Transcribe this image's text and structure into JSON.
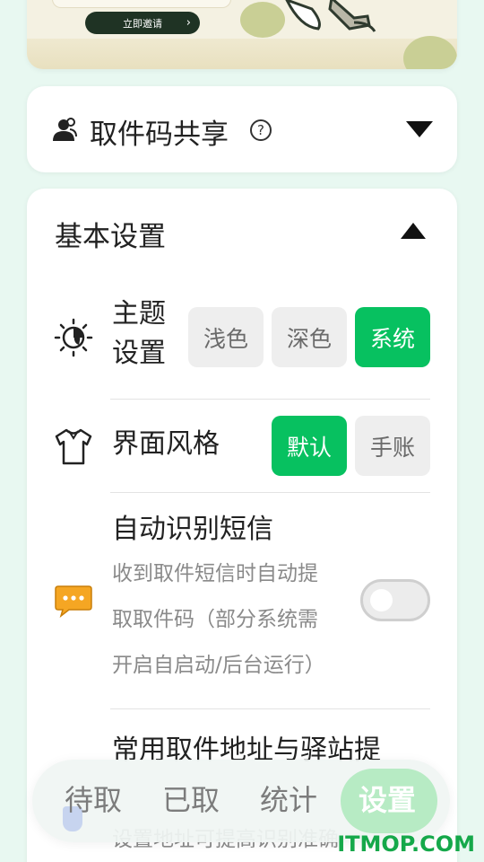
{
  "banner": {
    "invite_label": "立即邀请"
  },
  "share_card": {
    "title": "取件码共享",
    "help_symbol": "?"
  },
  "basic_settings": {
    "title": "基本设置",
    "theme": {
      "label_line1": "主题",
      "label_line2": "设置",
      "options": [
        "浅色",
        "深色",
        "系统"
      ],
      "selected": "系统"
    },
    "ui_style": {
      "label": "界面风格",
      "options": [
        "默认",
        "手账"
      ],
      "selected": "默认"
    },
    "sms": {
      "label": "自动识别短信",
      "desc_line1": "收到取件短信时自动提",
      "desc_line2": "取取件码（部分系统需",
      "desc_line3": "开启自启动/后台运行）",
      "enabled": false
    },
    "address": {
      "label": "常用取件地址与驿站提",
      "desc": "设置地址可提高识别准确"
    }
  },
  "bottom_nav": {
    "items": [
      "待取",
      "已取",
      "统计",
      "设置"
    ],
    "active": "设置"
  },
  "watermark": "ITMOP.COM",
  "colors": {
    "accent": "#07c160",
    "nav_active_bg": "#b7ebc4",
    "background": "#e8f8f1"
  }
}
